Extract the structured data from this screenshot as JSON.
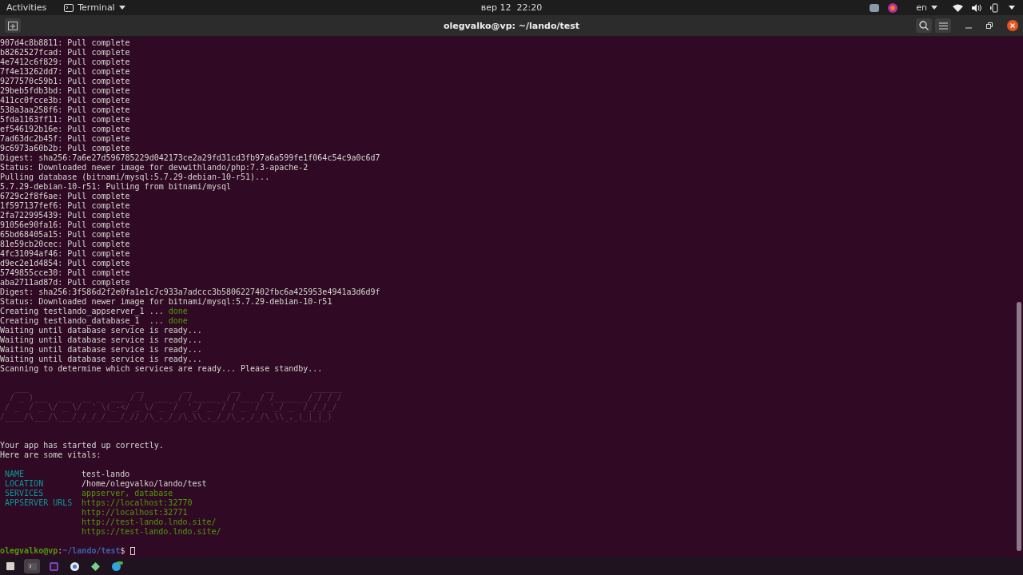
{
  "top_bar": {
    "activities": "Activities",
    "app_menu": "Terminal",
    "clock": "вер 12  22:20",
    "language": "en"
  },
  "window": {
    "title": "olegvalko@vp: ~/lando/test"
  },
  "log": [
    {
      "kind": "plain",
      "text": "907d4c8b8811: Pull complete"
    },
    {
      "kind": "plain",
      "text": "b8262527fcad: Pull complete"
    },
    {
      "kind": "plain",
      "text": "4e7412c6f829: Pull complete"
    },
    {
      "kind": "plain",
      "text": "7f4e13262dd7: Pull complete"
    },
    {
      "kind": "plain",
      "text": "9277570c59b1: Pull complete"
    },
    {
      "kind": "plain",
      "text": "29beb5fdb3bd: Pull complete"
    },
    {
      "kind": "plain",
      "text": "411cc0fcce3b: Pull complete"
    },
    {
      "kind": "plain",
      "text": "538a3aa258f6: Pull complete"
    },
    {
      "kind": "plain",
      "text": "5fda1163ff11: Pull complete"
    },
    {
      "kind": "plain",
      "text": "ef546192b16e: Pull complete"
    },
    {
      "kind": "plain",
      "text": "7ad63dc2b45f: Pull complete"
    },
    {
      "kind": "plain",
      "text": "9c6973a60b2b: Pull complete"
    },
    {
      "kind": "plain",
      "text": "Digest: sha256:7a6e27d596785229d042173ce2a29fd31cd3fb97a6a599fe1f064c54c9a0c6d7"
    },
    {
      "kind": "plain",
      "text": "Status: Downloaded newer image for devwithlando/php:7.3-apache-2"
    },
    {
      "kind": "plain",
      "text": "Pulling database (bitnami/mysql:5.7.29-debian-10-r51)..."
    },
    {
      "kind": "plain",
      "text": "5.7.29-debian-10-r51: Pulling from bitnami/mysql"
    },
    {
      "kind": "plain",
      "text": "6729c2f8f6ae: Pull complete"
    },
    {
      "kind": "plain",
      "text": "1f597137fef6: Pull complete"
    },
    {
      "kind": "plain",
      "text": "2fa722995439: Pull complete"
    },
    {
      "kind": "plain",
      "text": "91056e90fa16: Pull complete"
    },
    {
      "kind": "plain",
      "text": "65bd68405a15: Pull complete"
    },
    {
      "kind": "plain",
      "text": "81e59cb20cec: Pull complete"
    },
    {
      "kind": "plain",
      "text": "4fc31094af46: Pull complete"
    },
    {
      "kind": "plain",
      "text": "d9ec2e1d4854: Pull complete"
    },
    {
      "kind": "plain",
      "text": "5749855cce30: Pull complete"
    },
    {
      "kind": "plain",
      "text": "aba2711ad87d: Pull complete"
    },
    {
      "kind": "plain",
      "text": "Digest: sha256:3f586d2f2e0fa1e1c7c933a7adccc3b5806227402fbc6a425953e4941a3d6d9f"
    },
    {
      "kind": "plain",
      "text": "Status: Downloaded newer image for bitnami/mysql:5.7.29-debian-10-r51"
    },
    {
      "kind": "status",
      "text": "Creating testlando_appserver_1 ... ",
      "status": "done"
    },
    {
      "kind": "status",
      "text": "Creating testlando_database_1  ... ",
      "status": "done"
    },
    {
      "kind": "plain",
      "text": "Waiting until database service is ready..."
    },
    {
      "kind": "plain",
      "text": "Waiting until database service is ready..."
    },
    {
      "kind": "plain",
      "text": "Waiting until database service is ready..."
    },
    {
      "kind": "plain",
      "text": "Waiting until database service is ready..."
    },
    {
      "kind": "plain",
      "text": "Scanning to determine which services are ready... Please standby..."
    }
  ],
  "banner": [
    "   ___                      __        __        __     __        ______",
    "  / _ )___  ___  __ _  ___ / /  ___ _/ /_____ _/ /__ _/ /_____ _/ / / /",
    " / _  / _ \\/ _ \\/  ' \\(_-</ _ \\/ _ `/  '_/ _ `/ / _ `/  '_/ _ `/_/_/_/",
    "/____/\\___/\\___/_/_/_/___/_//_/\\_,_/_/\\_\\\\_,_/_/\\_,_/_/\\_\\\\_,_(_|_|_)"
  ],
  "messages": [
    "Your app has started up correctly.",
    "Here are some vitals:"
  ],
  "vitals": [
    {
      "label": "NAME",
      "values": [
        {
          "kind": "plain",
          "text": "test-lando"
        }
      ]
    },
    {
      "label": "LOCATION",
      "values": [
        {
          "kind": "plain",
          "text": "/home/olegvalko/lando/test"
        }
      ]
    },
    {
      "label": "SERVICES",
      "values": [
        {
          "kind": "green",
          "text": "appserver, database"
        }
      ]
    },
    {
      "label": "APPSERVER URLS",
      "values": [
        {
          "kind": "green",
          "text": "https://localhost:32770"
        },
        {
          "kind": "green",
          "text": "http://localhost:32771"
        },
        {
          "kind": "green",
          "text": "http://test-lando.lndo.site/"
        },
        {
          "kind": "green",
          "text": "https://test-lando.lndo.site/"
        }
      ]
    }
  ],
  "prompt": {
    "user_host": "olegvalko@vp",
    "separator": ":",
    "path": "~/lando/test",
    "symbol": "$"
  }
}
